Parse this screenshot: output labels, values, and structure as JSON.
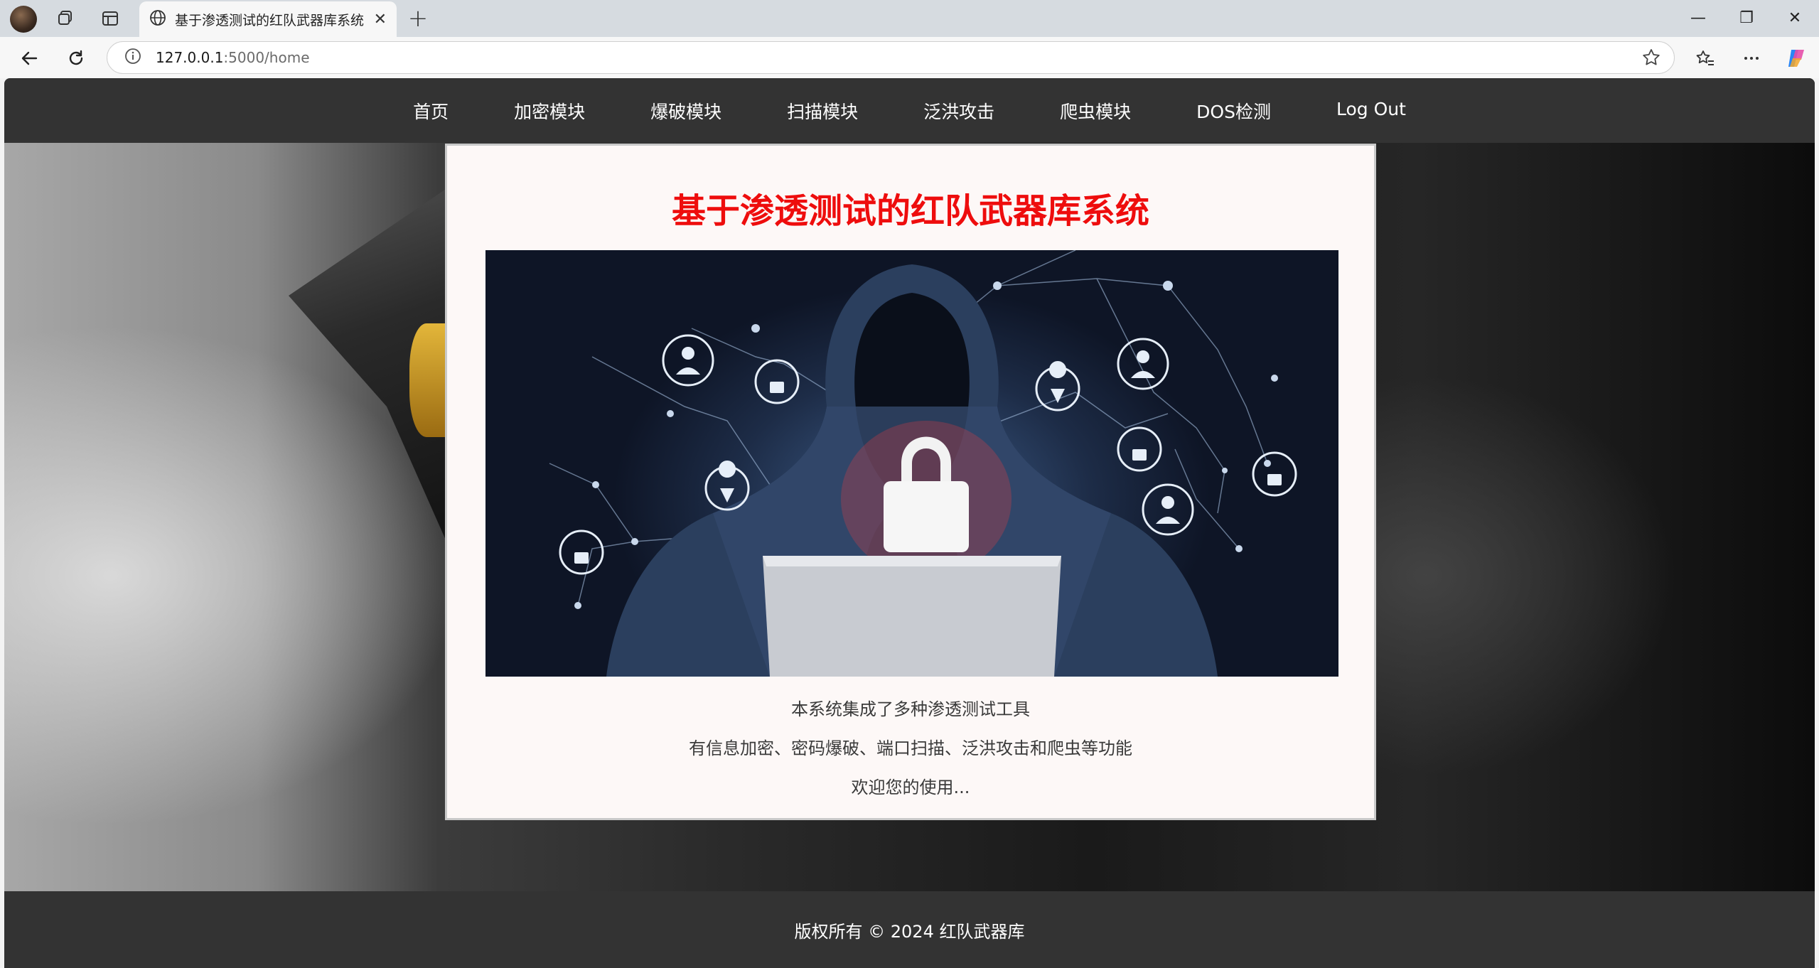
{
  "browser": {
    "tab_title": "基于渗透测试的红队武器库系统",
    "tab_close": "✕",
    "new_tab": "+",
    "url_host": "127.0.0.1",
    "url_rest": ":5000/home",
    "window": {
      "minimize": "—",
      "restore": "❐",
      "close": "✕"
    }
  },
  "navbar": {
    "items": [
      "首页",
      "加密模块",
      "爆破模块",
      "扫描模块",
      "泛洪攻击",
      "爬虫模块",
      "DOS检测"
    ],
    "logout": "Log Out"
  },
  "main": {
    "title": "基于渗透测试的红队武器库系统",
    "lines": [
      "本系统集成了多种渗透测试工具",
      "有信息加密、密码爆破、端口扫描、泛洪攻击和爬虫等功能",
      "欢迎您的使用..."
    ]
  },
  "footer": {
    "text": "版权所有 © 2024 红队武器库"
  },
  "colors": {
    "title_red": "#ee0d0d",
    "navbar": "#333333",
    "card_bg": "#fdf8f7"
  }
}
